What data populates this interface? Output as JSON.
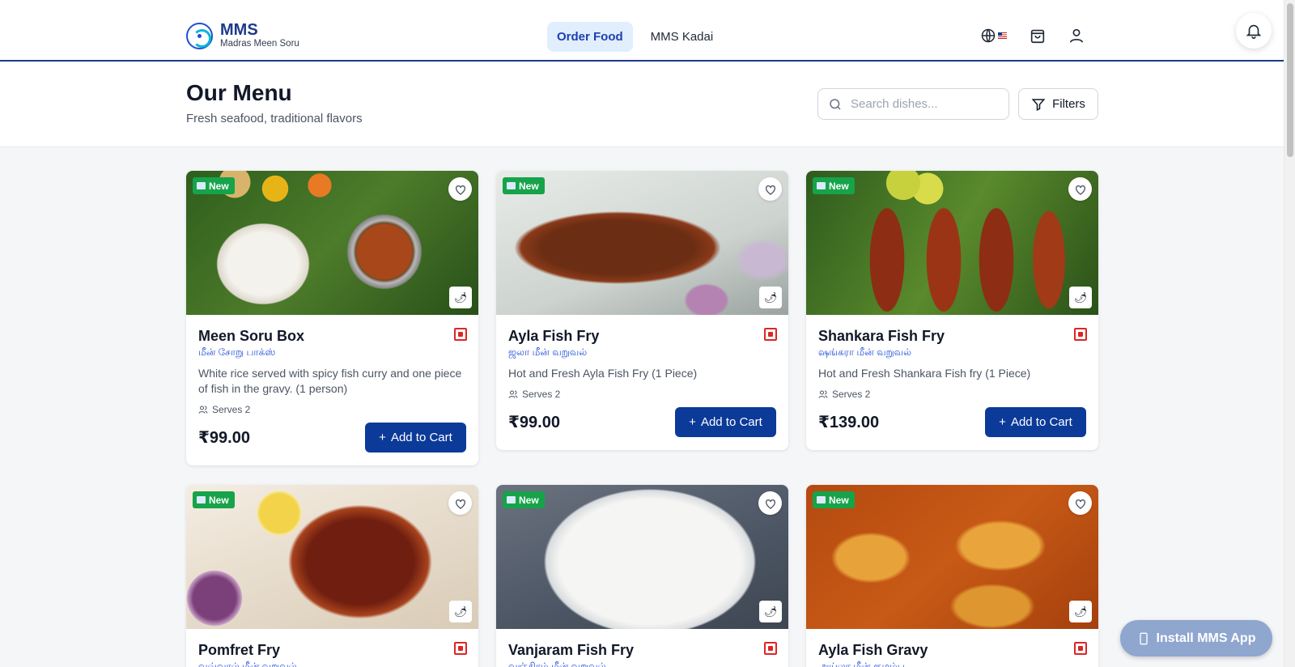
{
  "brand": {
    "name": "MMS",
    "subtitle": "Madras Meen Soru"
  },
  "nav": [
    {
      "label": "Order Food",
      "active": true
    },
    {
      "label": "MMS Kadai",
      "active": false
    }
  ],
  "header_icons": [
    "globe-icon",
    "us-flag-icon",
    "shopping-bag-icon",
    "user-icon",
    "bell-icon"
  ],
  "page": {
    "title": "Our Menu",
    "subtitle": "Fresh seafood, traditional flavors"
  },
  "search": {
    "placeholder": "Search dishes...",
    "value": ""
  },
  "filters_label": "Filters",
  "badge_label": "New",
  "add_to_cart_label": "Add to Cart",
  "items": [
    {
      "title": "Meen Soru Box",
      "tamil": "மீன் சோறு பாக்ஸ்",
      "description": "White rice served with spicy fish curry and one piece of fish in the gravy. (1 person)",
      "serves": "Serves 2",
      "price": "₹99.00"
    },
    {
      "title": "Ayla Fish Fry",
      "tamil": "ஜலா மீன் வறுவல்",
      "description": "Hot and Fresh Ayla Fish Fry (1 Piece)",
      "serves": "Serves 2",
      "price": "₹99.00"
    },
    {
      "title": "Shankara Fish Fry",
      "tamil": "ஷங்கரா மீன் வறுவல்",
      "description": "Hot and Fresh Shankara Fish fry (1 Piece)",
      "serves": "Serves 2",
      "price": "₹139.00"
    },
    {
      "title": "Pomfret Fry",
      "tamil": "வவ்வால் மீன் வறுவல்"
    },
    {
      "title": "Vanjaram Fish Fry",
      "tamil": "வஞ்சிரம் மீன் வறுவல்"
    },
    {
      "title": "Ayla Fish Gravy",
      "tamil": "அய்லா மீன் குழம்பு"
    }
  ],
  "install_app_label": "Install MMS App",
  "colors": {
    "primary": "#0b3a99",
    "accent_nav": "#e0eefe",
    "badge_new": "#16a34a",
    "nonveg": "#dc2626"
  }
}
